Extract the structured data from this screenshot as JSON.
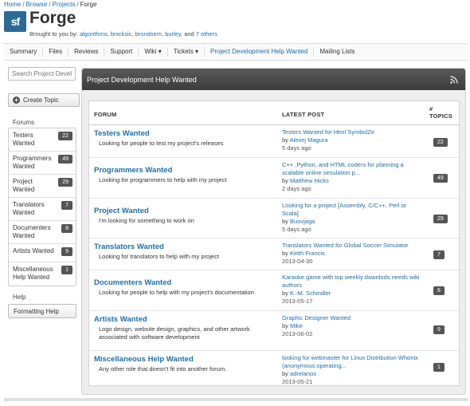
{
  "breadcrumb": [
    "Home",
    "Browse",
    "Projects",
    "Forge"
  ],
  "header": {
    "logo_text": "sf",
    "title": "Forge",
    "byline_prefix": "Brought to you by:",
    "authors": [
      "algorithms",
      "bnicksic",
      "brondsem",
      "burley"
    ],
    "byline_and": "and",
    "others": "7 others"
  },
  "nav": [
    "Summary",
    "Files",
    "Reviews",
    "Support",
    "Wiki ▾",
    "Tickets ▾",
    "Project Development Help Wanted",
    "Mailing Lists"
  ],
  "sidebar": {
    "search_placeholder": "Search Project Develo",
    "create_topic": "Create Topic",
    "forums_heading": "Forums",
    "forums": [
      {
        "label": "Testers Wanted",
        "count": "22"
      },
      {
        "label": "Programmers Wanted",
        "count": "49"
      },
      {
        "label": "Project Wanted",
        "count": "29"
      },
      {
        "label": "Translators Wanted",
        "count": "7"
      },
      {
        "label": "Documenters Wanted",
        "count": "8"
      },
      {
        "label": "Artists Wanted",
        "count": "9"
      },
      {
        "label": "Miscellaneous Help Wanted",
        "count": "1"
      }
    ],
    "help_heading": "Help",
    "formatting_help": "Formatting Help"
  },
  "panel": {
    "title": "Project Development Help Wanted",
    "columns": {
      "forum": "FORUM",
      "latest": "LATEST POST",
      "topics": "# TOPICS"
    },
    "rows": [
      {
        "name": "Testers Wanted",
        "desc": "Looking for people to test my project's releases",
        "post": "Testers Wanted for Html SymbolZe",
        "by_prefix": "by",
        "author": "Alexej Magura",
        "date": "5 days ago",
        "topics": "22"
      },
      {
        "name": "Programmers Wanted",
        "desc": "Looking for programmers to help with my project",
        "post": "C++ ,Python, and HTML coders for planning a scalable online simulation p...",
        "by_prefix": "by",
        "author": "Matthew Hicks",
        "date": "2 days ago",
        "topics": "49"
      },
      {
        "name": "Project Wanted",
        "desc": "I'm looking for something to work on",
        "post": "Looking for a project [Assembly, C/C++, Perl or Scala]",
        "by_prefix": "by",
        "author": "Buovjaga",
        "date": "5 days ago",
        "topics": "29"
      },
      {
        "name": "Translators Wanted",
        "desc": "Looking for translators to help with my project",
        "post": "Translators Wanted for Global Soccer Simulator",
        "by_prefix": "by",
        "author": "Keith Francis",
        "date": "2013-04-30",
        "topics": "7"
      },
      {
        "name": "Documenters Wanted",
        "desc": "Looking for people to help with my project's documentation",
        "post": "Karaoke game with top weekly downlods needs wiki authors",
        "by_prefix": "by",
        "author": "K.-M. Schindler",
        "date": "2013-05-17",
        "topics": "8"
      },
      {
        "name": "Artists Wanted",
        "desc": "Logo design, website design, graphics, and other artwork associated with software development",
        "post": "Graphic Designer Wanted",
        "by_prefix": "by",
        "author": "Mike",
        "date": "2013-06-02",
        "topics": "9"
      },
      {
        "name": "Miscellaneous Help Wanted",
        "desc": "Any other role that doesn't fit into another forum.",
        "post": "looking for webmaster for Linux Distribution Whonix (anonymous operating...",
        "by_prefix": "by",
        "author": "adrelanos",
        "date": "2013-05-21",
        "topics": "1"
      }
    ]
  },
  "colors": {
    "link": "#1f6fa8",
    "logo": "#2a6a96",
    "panel_header": "#4a4a4a",
    "badge": "#555555"
  }
}
